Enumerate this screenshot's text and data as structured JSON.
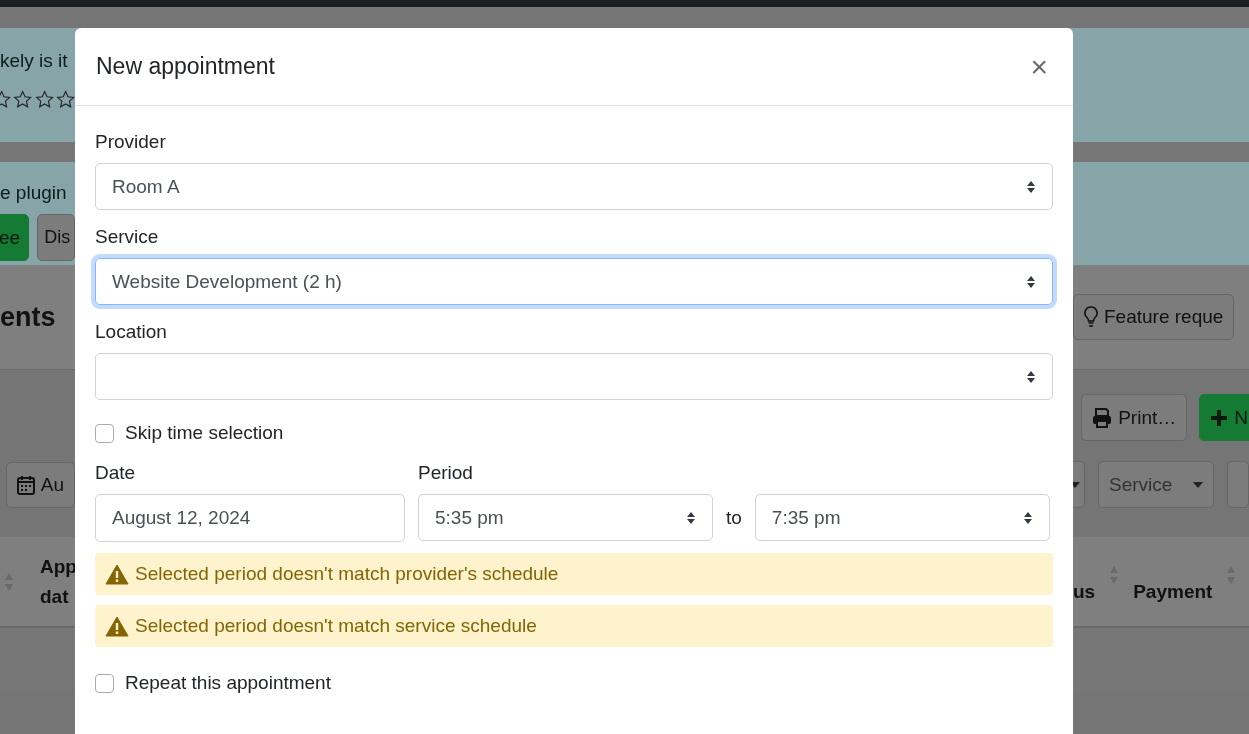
{
  "background_page": {
    "rating_notice": {
      "text": "kely is it",
      "stars": 0
    },
    "plugin_notice": {
      "text": "e plugin",
      "buttons": [
        {
          "label": "ee",
          "kind": "primary"
        },
        {
          "label": "Dis",
          "kind": "secondary"
        }
      ]
    },
    "heading": "ents",
    "header_button": {
      "label": "Feature reque"
    },
    "toolbar_buttons": [
      {
        "label": "Print…",
        "kind": "secondary"
      },
      {
        "label": "N",
        "kind": "primary"
      }
    ],
    "date_filter": {
      "label": "Au"
    },
    "service_filter": {
      "label": "Service"
    },
    "table": {
      "columns": [
        {
          "lines": [
            "App",
            "dat"
          ]
        },
        {
          "lines": [
            "us"
          ]
        },
        {
          "lines": [
            "Payment"
          ]
        }
      ]
    }
  },
  "modal": {
    "title": "New appointment",
    "close": "×",
    "fields": [
      {
        "kind": "select",
        "label": "Provider",
        "value": "Room A",
        "focused": false
      },
      {
        "kind": "select",
        "label": "Service",
        "value": "Website Development (2 h)",
        "focused": true
      },
      {
        "kind": "select",
        "label": "Location",
        "focused": false
      }
    ],
    "skip_time": {
      "label": "Skip time selection",
      "checked": false
    },
    "date": {
      "label": "Date",
      "value": "August 12, 2024"
    },
    "period": {
      "label": "Period",
      "start": "5:35 pm",
      "separator": "to",
      "end": "7:35 pm"
    },
    "warnings": [
      "Selected period doesn't match provider's schedule",
      "Selected period doesn't match service schedule"
    ],
    "repeat": {
      "label": "Repeat this appointment",
      "checked": false
    }
  }
}
